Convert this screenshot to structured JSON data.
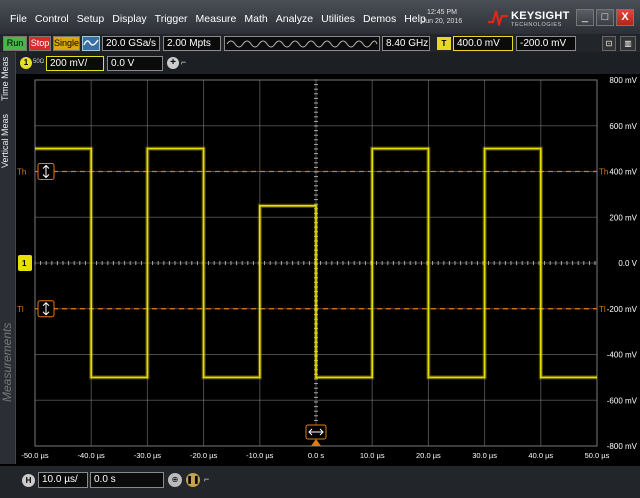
{
  "menu": [
    "File",
    "Control",
    "Setup",
    "Display",
    "Trigger",
    "Measure",
    "Math",
    "Analyze",
    "Utilities",
    "Demos",
    "Help"
  ],
  "clock": {
    "time": "12:45 PM",
    "date": "Jun 20, 2016"
  },
  "brand": {
    "name": "KEYSIGHT",
    "sub": "TECHNOLOGIES"
  },
  "window_buttons": {
    "minimize": "_",
    "maximize": "□",
    "close": "X"
  },
  "acquisition": {
    "run": "Run",
    "stop": "Stop",
    "single": "Single",
    "sample_rate": "20.0 GSa/s",
    "memory_depth": "2.00 Mpts",
    "bandwidth": "8.40 GHz"
  },
  "trigger": {
    "badge": "T",
    "level": "400.0 mV",
    "offset": "-200.0 mV"
  },
  "channel1": {
    "badge": "1",
    "impedance": "50Ω",
    "scale": "200 mV/",
    "offset": "0.0 V"
  },
  "left_tabs": {
    "time": "Time Meas",
    "vertical": "Vertical Meas",
    "measurements": "Measurements"
  },
  "timebase": {
    "badge": "H",
    "scale": "10.0 µs/",
    "position": "0.0 s"
  },
  "display": {
    "trace_color": "#e8e000",
    "threshold_color": "#e07a10",
    "grid_color": "#7a7a7a",
    "background": "#000000"
  },
  "chart_data": {
    "type": "line",
    "title": "",
    "xlabel": "",
    "ylabel": "",
    "x_unit": "µs",
    "y_unit": "mV",
    "xlim": [
      -50,
      50
    ],
    "ylim": [
      -800,
      800
    ],
    "x_ticks": [
      "-50.0 µs",
      "-40.0 µs",
      "-30.0 µs",
      "-20.0 µs",
      "-10.0 µs",
      "0.0 s",
      "10.0 µs",
      "20.0 µs",
      "30.0 µs",
      "40.0 µs",
      "50.0 µs"
    ],
    "y_ticks": [
      {
        "v": 800,
        "label": "800 mV"
      },
      {
        "v": 600,
        "label": "600 mV"
      },
      {
        "v": 400,
        "label": "400 mV"
      },
      {
        "v": 200,
        "label": "200 mV"
      },
      {
        "v": 0,
        "label": "0.0 V"
      },
      {
        "v": -200,
        "label": "-200 mV"
      },
      {
        "v": -400,
        "label": "-400 mV"
      },
      {
        "v": -600,
        "label": "-600 mV"
      },
      {
        "v": -800,
        "label": "-800 mV"
      }
    ],
    "series": [
      {
        "x": [
          -50,
          -40,
          -40,
          -30,
          -30,
          -20,
          -20,
          -10,
          -10,
          0,
          0,
          10,
          10,
          20,
          20,
          30,
          30,
          40,
          40,
          50
        ],
        "y": [
          500,
          500,
          -500,
          -500,
          500,
          500,
          -500,
          -500,
          250,
          250,
          -500,
          -500,
          500,
          500,
          -500,
          -500,
          500,
          500,
          -500,
          -500
        ]
      }
    ],
    "thresholds": [
      {
        "label": "Th",
        "value": 400
      },
      {
        "label": "Tl",
        "value": -200
      }
    ]
  }
}
